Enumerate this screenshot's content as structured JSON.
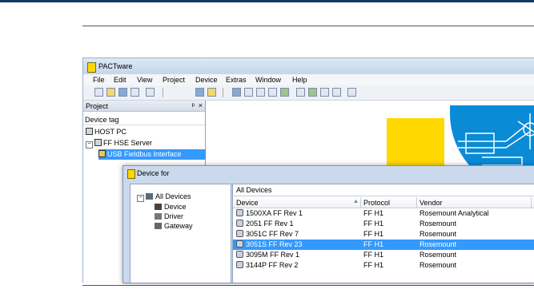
{
  "app": {
    "title": "PACTware",
    "menu": [
      "File",
      "Edit",
      "View",
      "Project",
      "Device",
      "Extras",
      "Window",
      "Help"
    ]
  },
  "project_panel": {
    "title": "Project",
    "pin_glyph": "ᵖ",
    "close_glyph": "×",
    "column_header": "Device tag",
    "tree": [
      {
        "label": "HOST PC",
        "icon": "computer-icon"
      },
      {
        "label": "FF HSE Server",
        "icon": "server-icon",
        "expander": "−"
      },
      {
        "label": "USB Fieldbus Interface",
        "icon": "interface-icon",
        "selected": true
      }
    ]
  },
  "dialog": {
    "title": "Device for",
    "filter_tree": [
      {
        "label": "All Devices",
        "icon": "all-devices-icon",
        "expander": "−"
      },
      {
        "label": "Device",
        "icon": "device-icon"
      },
      {
        "label": "Driver",
        "icon": "driver-icon"
      },
      {
        "label": "Gateway",
        "icon": "gateway-icon"
      }
    ],
    "list_title": "All Devices",
    "columns": {
      "device": "Device",
      "protocol": "Protocol",
      "vendor": "Vendor"
    },
    "sort_glyph": "▲",
    "rows": [
      {
        "device": "1500XA FF Rev 1",
        "protocol": "FF H1",
        "vendor": "Rosemount Analytical"
      },
      {
        "device": "2051 FF Rev 1",
        "protocol": "FF H1",
        "vendor": "Rosemount"
      },
      {
        "device": "3051C FF Rev 7",
        "protocol": "FF H1",
        "vendor": "Rosemount"
      },
      {
        "device": "3051S FF Rev 23",
        "protocol": "FF H1",
        "vendor": "Rosemount",
        "selected": true
      },
      {
        "device": "3095M FF Rev 1",
        "protocol": "FF H1",
        "vendor": "Rosemount"
      },
      {
        "device": "3144P FF Rev 2",
        "protocol": "FF H1",
        "vendor": "Rosemount"
      }
    ]
  },
  "colors": {
    "header_rule": "#163763",
    "selection": "#3399ff",
    "logo_yellow": "#ffd800",
    "logo_blue": "#0a8bd6"
  }
}
